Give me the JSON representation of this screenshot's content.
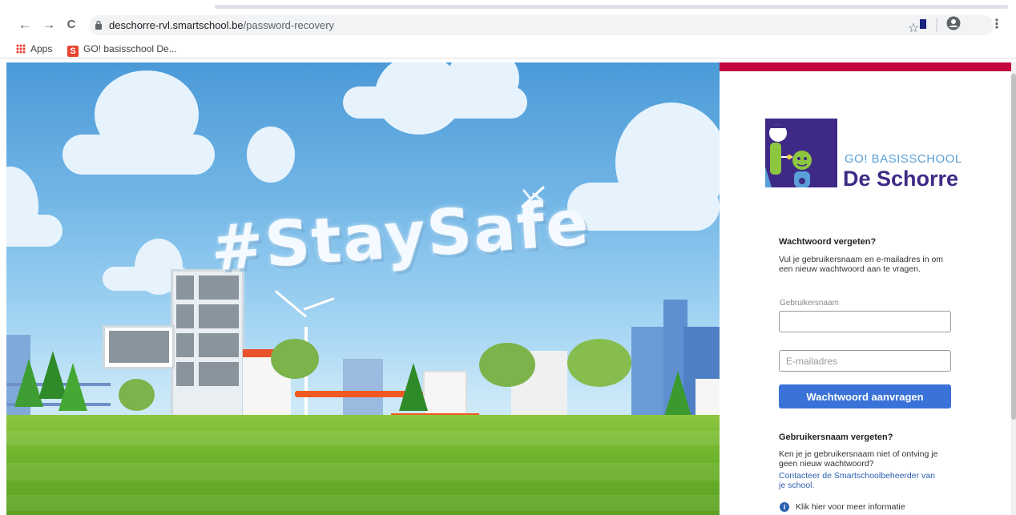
{
  "browser": {
    "url_host": "deschorre-rvl.smartschool.be",
    "url_path": "/password-recovery",
    "back_icon": "←",
    "forward_icon": "→",
    "reload_icon": "C",
    "star_icon": "☆",
    "menu_icon": "⋮"
  },
  "bookmarks": {
    "apps_label": "Apps",
    "school_favicon": "S",
    "school_label": "GO! basisschool De..."
  },
  "hero": {
    "hashtag": "#StaySafe"
  },
  "logo": {
    "subtitle": "GO! BASISSCHOOL",
    "title": "De Schorre",
    "brand_color": "#3e2a86",
    "accent_color": "#c3093f"
  },
  "form": {
    "heading": "Wachtwoord vergeten?",
    "intro": "Vul je gebruikersnaam en e-mailadres in om een nieuw wachtwoord aan te vragen.",
    "username_label": "Gebruikersnaam",
    "username_value": "",
    "email_placeholder": "E-mailadres",
    "email_value": "",
    "submit_label": "Wachtwoord aanvragen",
    "button_color": "#3a73d8"
  },
  "forgot_username": {
    "heading": "Gebruikersnaam vergeten?",
    "text": "Ken je je gebruikersnaam niet of ontving je geen nieuw wachtwoord?",
    "link": "Contacteer de Smartschoolbeheerder van je school.",
    "info": "Klik hier voor meer informatie",
    "info_icon": "i"
  }
}
